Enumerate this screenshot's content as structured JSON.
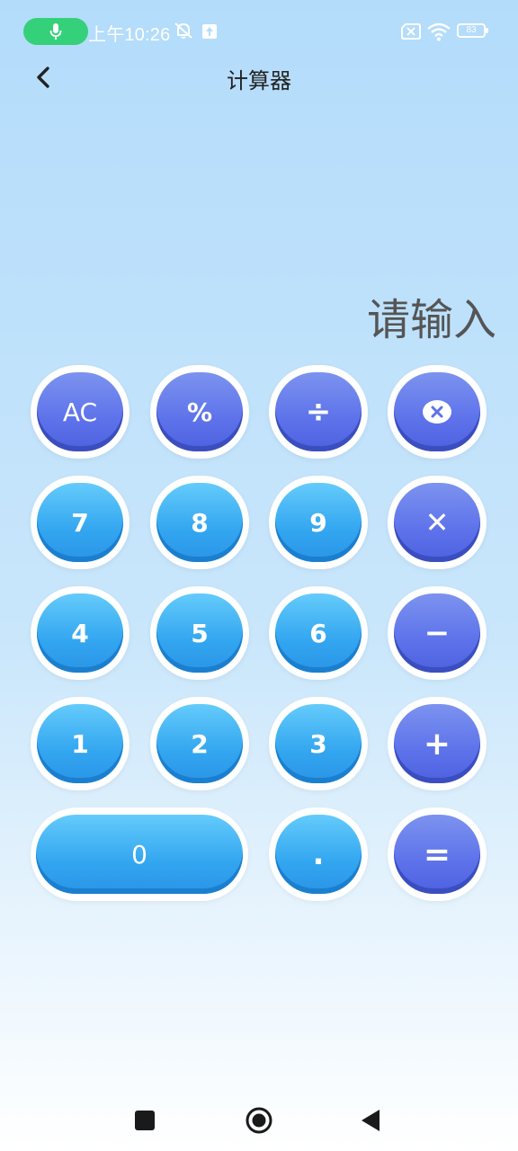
{
  "status_bar": {
    "time": "上午10:26",
    "battery_level": "83",
    "icons": [
      "mic-icon",
      "mute-icon",
      "upload-icon",
      "no-sim-icon",
      "wifi-icon",
      "battery-icon"
    ]
  },
  "header": {
    "title": "计算器",
    "back_icon": "back-arrow-icon"
  },
  "display": {
    "placeholder": "请输入"
  },
  "keys": {
    "ac": "AC",
    "percent": "%",
    "divide": "÷",
    "backspace_icon": "backspace-icon",
    "seven": "7",
    "eight": "8",
    "nine": "9",
    "multiply": "✕",
    "four": "4",
    "five": "5",
    "six": "6",
    "minus": "−",
    "one": "1",
    "two": "2",
    "three": "3",
    "plus": "+",
    "zero": "0",
    "dot": ".",
    "equals": "="
  },
  "colors": {
    "number_key": "#3aaaf2",
    "operator_key": "#5d72ea",
    "background_top": "#b3dcfb"
  },
  "nav_bar": {
    "icons": [
      "recent-apps-icon",
      "home-icon",
      "back-icon"
    ]
  }
}
